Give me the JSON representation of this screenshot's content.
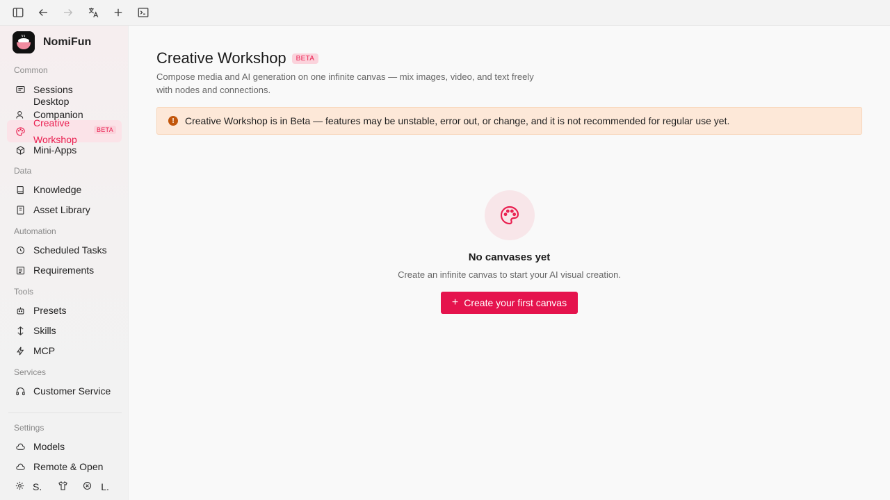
{
  "app": {
    "name": "NomiFun"
  },
  "sidebar": {
    "sections": {
      "common": "Common",
      "data": "Data",
      "automation": "Automation",
      "tools": "Tools",
      "services": "Services",
      "settings": "Settings"
    },
    "items": {
      "sessions": "Sessions",
      "desktop": "Desktop",
      "companion": "Companion",
      "creative_workshop": "Creative Workshop",
      "creative_workshop_badge": "BETA",
      "mini_apps": "Mini-Apps",
      "knowledge": "Knowledge",
      "asset_library": "Asset Library",
      "scheduled_tasks": "Scheduled Tasks",
      "requirements": "Requirements",
      "presets": "Presets",
      "skills": "Skills",
      "mcp": "MCP",
      "customer_service": "Customer Service",
      "models": "Models",
      "remote_open": "Remote & Open"
    },
    "bottom": {
      "settings_short": "S.",
      "language_short": "L."
    }
  },
  "main": {
    "title": "Creative Workshop",
    "title_badge": "BETA",
    "description": "Compose media and AI generation on one infinite canvas — mix images, video, and text freely with nodes and connections.",
    "alert": "Creative Workshop is in Beta — features may be unstable, error out, or change, and it is not recommended for regular use yet.",
    "empty": {
      "title": "No canvases yet",
      "subtitle": "Create an infinite canvas to start your AI visual creation.",
      "button": "Create your first canvas"
    }
  },
  "colors": {
    "accent": "#e5134d",
    "accent_soft": "#fbe3e8",
    "alert_bg": "#fde8d8",
    "alert_icon": "#c2560b"
  }
}
